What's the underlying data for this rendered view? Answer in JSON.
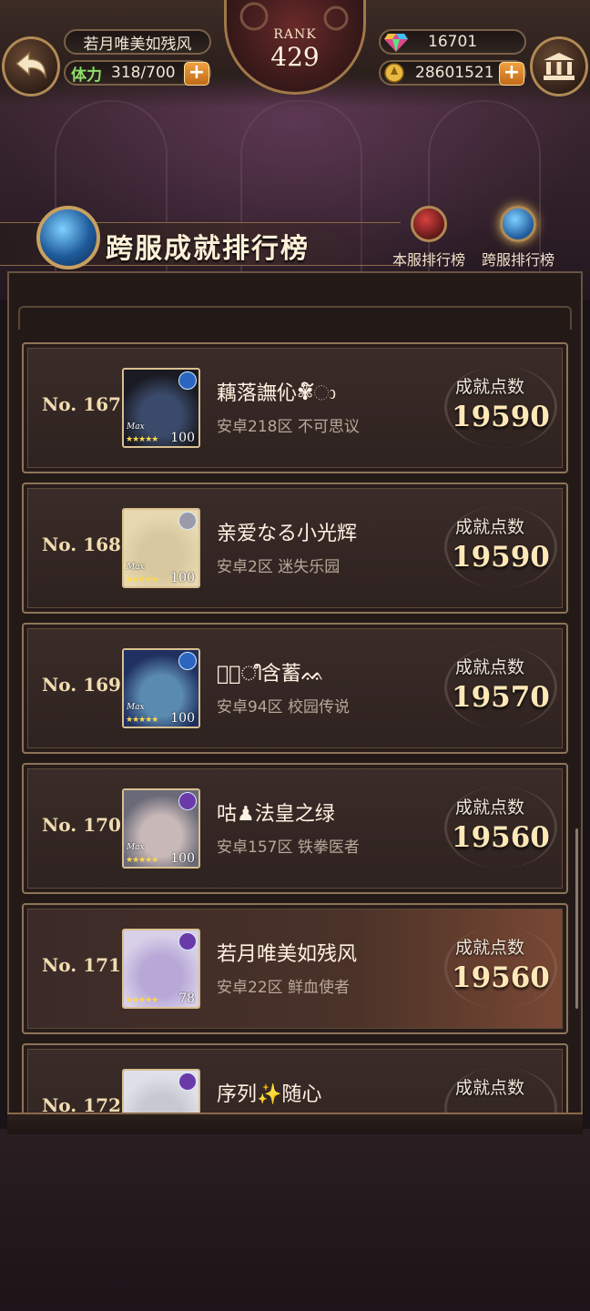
{
  "player": {
    "name": "若月唯美如残风",
    "stamina_label": "体力",
    "stamina": "318/700",
    "rank_label": "RANK",
    "rank": "429",
    "gems": "16701",
    "gold": "28601521"
  },
  "header": {
    "title": "跨服成就排行榜",
    "tabs": [
      {
        "label": "本服排行榜",
        "active": false
      },
      {
        "label": "跨服排行榜",
        "active": true
      }
    ]
  },
  "score_label": "成就点数",
  "rows": [
    {
      "rank": "No. 167",
      "name": "藕落譕伈✾໌ා",
      "server": "安卓218区 不可思议",
      "score": "19590",
      "level": "100",
      "max": "Max",
      "stars": "★★★★★",
      "mini_level": "100",
      "elem_color": "#2a66c0",
      "face_color": "#3a4a6a",
      "hair_color": "#1a1a22"
    },
    {
      "rank": "No. 168",
      "name": "亲爱なる小光辉",
      "server": "安卓2区 迷失乐园",
      "score": "19590",
      "level": "100",
      "max": "Max",
      "stars": "★★★★★",
      "mini_level": "100",
      "elem_color": "#9a9aa8",
      "face_color": "#d8c8a0",
      "hair_color": "#e8d8b0"
    },
    {
      "rank": "No. 169",
      "name": "ᕲ᷂ീ含蓄ᨐ",
      "server": "安卓94区 校园传说",
      "score": "19570",
      "level": "100",
      "max": "Max",
      "stars": "★★★★★",
      "mini_level": "100",
      "elem_color": "#2a66c0",
      "face_color": "#5a8ab0",
      "hair_color": "#203060"
    },
    {
      "rank": "No. 170",
      "name": "咕♟法皇之绿",
      "server": "安卓157区 铁拳医者",
      "score": "19560",
      "level": "100",
      "max": "Max",
      "stars": "★★★★★",
      "mini_level": "100",
      "elem_color": "#6a3aa8",
      "face_color": "#c8b8b8",
      "hair_color": "#6a6a78"
    },
    {
      "rank": "No. 171",
      "name": "若月唯美如残风",
      "server": "安卓22区 鲜血使者",
      "score": "19560",
      "level": "78",
      "max": "",
      "stars": "★★★★★",
      "mini_level": "",
      "elem_color": "#6a3aa8",
      "face_color": "#b8a8d8",
      "hair_color": "#d8d0e8"
    },
    {
      "rank": "No. 172",
      "name": "序列✨随心",
      "server": "",
      "score": "",
      "level": "",
      "max": "",
      "stars": "",
      "mini_level": "",
      "elem_color": "#6a3aa8",
      "face_color": "#c8c8d0",
      "hair_color": "#e0e0e8"
    }
  ]
}
